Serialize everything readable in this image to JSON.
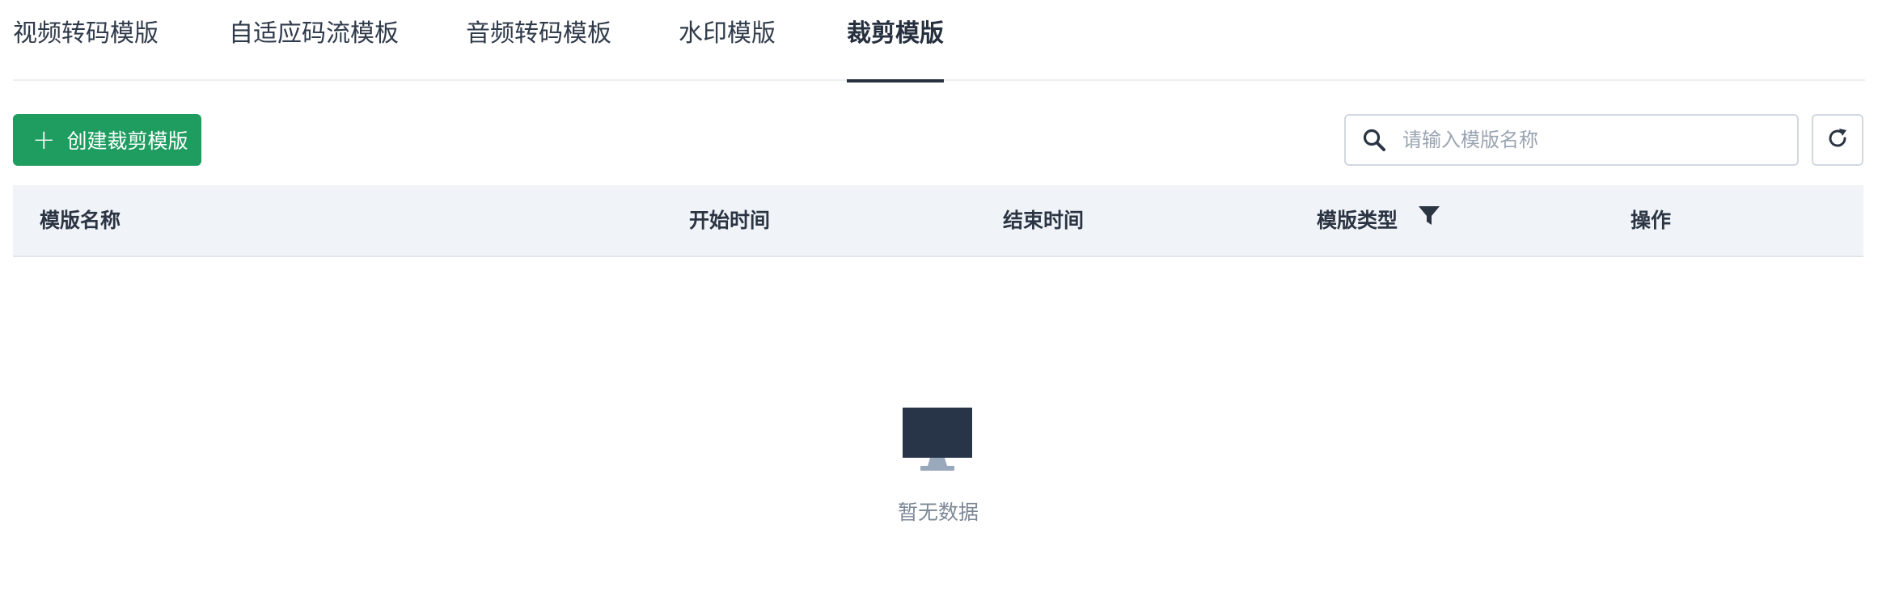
{
  "tabs": [
    {
      "label": "视频转码模版",
      "active": false
    },
    {
      "label": "自适应码流模板",
      "active": false
    },
    {
      "label": "音频转码模板",
      "active": false
    },
    {
      "label": "水印模版",
      "active": false
    },
    {
      "label": "裁剪模版",
      "active": true
    }
  ],
  "toolbar": {
    "create_label": "创建裁剪模版",
    "search_placeholder": "请输入模版名称",
    "search_value": ""
  },
  "table": {
    "columns": [
      "模版名称",
      "开始时间",
      "结束时间",
      "模版类型",
      "操作"
    ],
    "rows": [],
    "empty_text": "暂无数据"
  },
  "colors": {
    "primary": "#1f9d61",
    "header_bg": "#f0f4f8",
    "active_tab": "#26303f"
  },
  "icons": [
    "plus-icon",
    "search-icon",
    "refresh-icon",
    "filter-icon",
    "empty-monitor-icon"
  ]
}
